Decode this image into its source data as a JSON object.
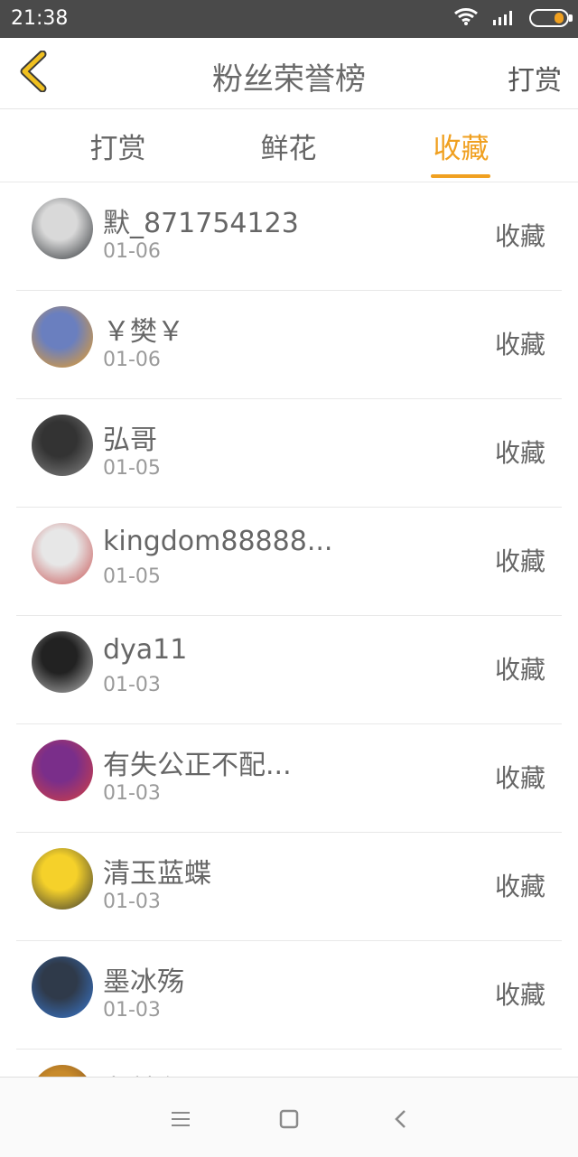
{
  "status_bar": {
    "time": "21:38",
    "icons": [
      "wifi-icon",
      "signal-icon",
      "battery-icon"
    ]
  },
  "header": {
    "title": "粉丝荣誉榜",
    "action_label": "打赏",
    "back_icon": "chevron-left-icon"
  },
  "tabs": [
    {
      "label": "打赏",
      "active": false
    },
    {
      "label": "鲜花",
      "active": false
    },
    {
      "label": "收藏",
      "active": true
    }
  ],
  "accent_color": "#f0a020",
  "items": [
    {
      "name": "默_871754123",
      "date": "01-06",
      "action": "收藏",
      "avatar_colors": [
        "#d9d9d9",
        "#2b2f33"
      ]
    },
    {
      "name": "￥樊￥",
      "date": "01-06",
      "action": "收藏",
      "avatar_colors": [
        "#6a7fbf",
        "#f0a020"
      ]
    },
    {
      "name": "弘哥",
      "date": "01-05",
      "action": "收藏",
      "avatar_colors": [
        "#333333",
        "#888888"
      ]
    },
    {
      "name": "kingdom88888...",
      "date": "01-05",
      "action": "收藏",
      "avatar_colors": [
        "#e7e7e7",
        "#c85050"
      ]
    },
    {
      "name": "dya11",
      "date": "01-03",
      "action": "收藏",
      "avatar_colors": [
        "#222222",
        "#bbbbbb"
      ]
    },
    {
      "name": "有失公正不配...",
      "date": "01-03",
      "action": "收藏",
      "avatar_colors": [
        "#7a2e8a",
        "#d84040"
      ]
    },
    {
      "name": "清玉蓝蝶",
      "date": "01-03",
      "action": "收藏",
      "avatar_colors": [
        "#f5d12a",
        "#333333"
      ]
    },
    {
      "name": "墨冰殇",
      "date": "01-03",
      "action": "收藏",
      "avatar_colors": [
        "#2f3a4a",
        "#3a7bd5"
      ]
    },
    {
      "name": "龙麟邂",
      "date": "",
      "action": "",
      "avatar_colors": [
        "#c88a2a",
        "#7a4a1a"
      ]
    }
  ],
  "nav": {
    "menu_icon": "menu-icon",
    "home_icon": "square-icon",
    "back_icon": "back-icon"
  }
}
